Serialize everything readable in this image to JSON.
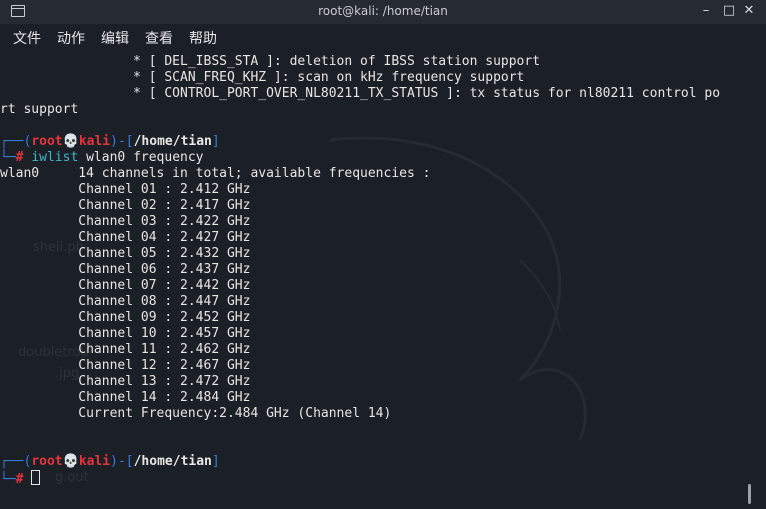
{
  "window": {
    "title": "root@kali: /home/tian"
  },
  "menu": {
    "file": "文件",
    "actions": "动作",
    "edit": "编辑",
    "view": "查看",
    "help": "帮助"
  },
  "controls": {
    "minimize": "–",
    "maximize": "□",
    "close": "✕"
  },
  "desktop_ghost": {
    "shell": "shell.ph",
    "doubletrouble": "doubletrou",
    "jpg": ".jpg",
    "out": "g.out"
  },
  "terminal": {
    "prev_output": [
      "                 * [ DEL_IBSS_STA ]: deletion of IBSS station support",
      "                 * [ SCAN_FREQ_KHZ ]: scan on kHz frequency support",
      "                 * [ CONTROL_PORT_OVER_NL80211_TX_STATUS ]: tx status for nl80211 control po",
      "rt support"
    ],
    "prompt": {
      "open": "┌──(",
      "user": "root",
      "skull": "💀",
      "host": "kali",
      "mid": ")-[",
      "path": "/home/tian",
      "close": "]",
      "second": "└─",
      "hash": "#"
    },
    "command_name": "iwlist",
    "command_args": " wlan0 frequency",
    "iface_line": "wlan0     14 channels in total; available frequencies :",
    "channels": [
      "          Channel 01 : 2.412 GHz",
      "          Channel 02 : 2.417 GHz",
      "          Channel 03 : 2.422 GHz",
      "          Channel 04 : 2.427 GHz",
      "          Channel 05 : 2.432 GHz",
      "          Channel 06 : 2.437 GHz",
      "          Channel 07 : 2.442 GHz",
      "          Channel 08 : 2.447 GHz",
      "          Channel 09 : 2.452 GHz",
      "          Channel 10 : 2.457 GHz",
      "          Channel 11 : 2.462 GHz",
      "          Channel 12 : 2.467 GHz",
      "          Channel 13 : 2.472 GHz",
      "          Channel 14 : 2.484 GHz"
    ],
    "current_freq": "          Current Frequency:2.484 GHz (Channel 14)"
  }
}
